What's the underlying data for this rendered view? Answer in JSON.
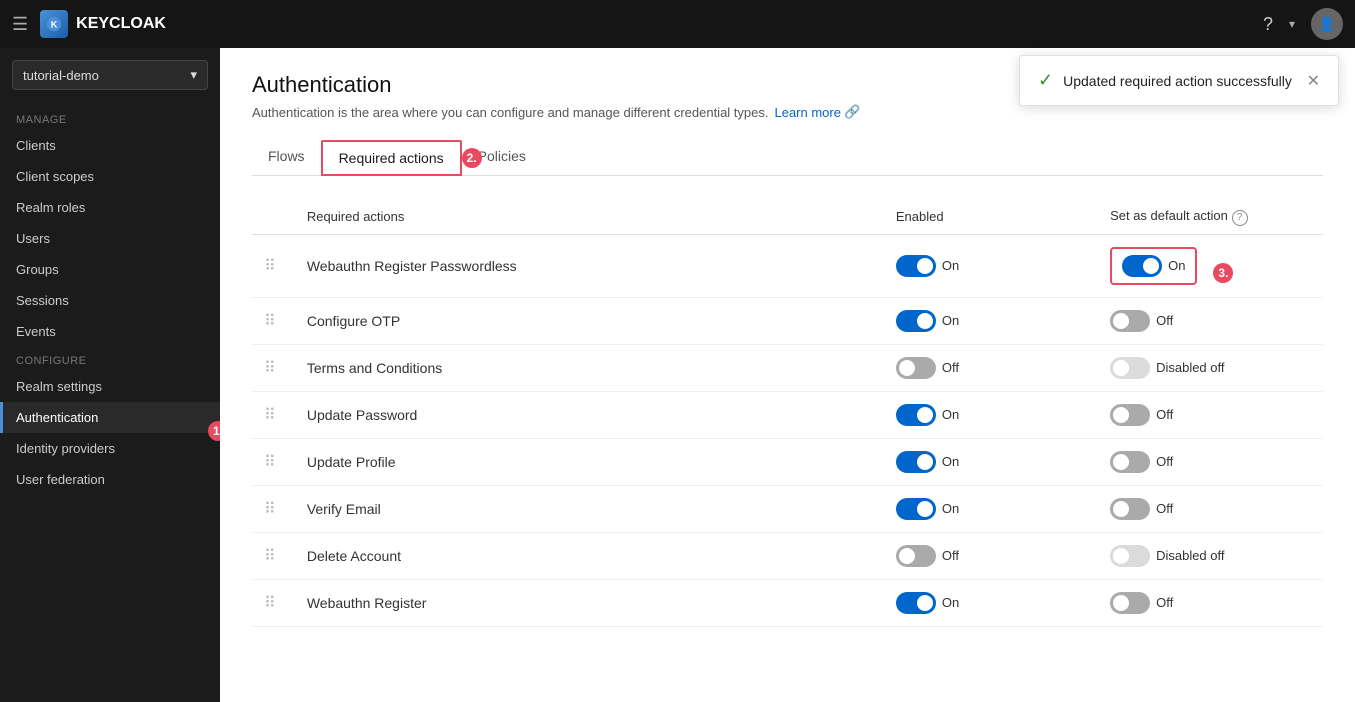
{
  "navbar": {
    "hamburger_icon": "☰",
    "brand_name": "KEYCLOAK",
    "help_icon": "?",
    "dropdown_arrow": "▾",
    "avatar_text": "👤"
  },
  "sidebar": {
    "realm_name": "tutorial-demo",
    "sections": {
      "manage_label": "Manage",
      "configure_label": "Configure"
    },
    "manage_items": [
      {
        "id": "clients",
        "label": "Clients",
        "active": false
      },
      {
        "id": "client-scopes",
        "label": "Client scopes",
        "active": false
      },
      {
        "id": "realm-roles",
        "label": "Realm roles",
        "active": false
      },
      {
        "id": "users",
        "label": "Users",
        "active": false
      },
      {
        "id": "groups",
        "label": "Groups",
        "active": false
      },
      {
        "id": "sessions",
        "label": "Sessions",
        "active": false
      },
      {
        "id": "events",
        "label": "Events",
        "active": false
      }
    ],
    "configure_items": [
      {
        "id": "realm-settings",
        "label": "Realm settings",
        "active": false
      },
      {
        "id": "authentication",
        "label": "Authentication",
        "active": true
      },
      {
        "id": "identity-providers",
        "label": "Identity providers",
        "active": false
      },
      {
        "id": "user-federation",
        "label": "User federation",
        "active": false
      }
    ]
  },
  "page": {
    "title": "Authentication",
    "description": "Authentication is the area where you can configure and manage different credential types.",
    "learn_more": "Learn more"
  },
  "tabs": [
    {
      "id": "flows",
      "label": "Flows",
      "active": false
    },
    {
      "id": "required-actions",
      "label": "Required actions",
      "active": true
    },
    {
      "id": "policies",
      "label": "Policies",
      "active": false
    }
  ],
  "table": {
    "headers": {
      "required_actions": "Required actions",
      "enabled": "Enabled",
      "set_as_default": "Set as default action"
    },
    "rows": [
      {
        "id": "webauthn-passwordless",
        "name": "Webauthn Register Passwordless",
        "enabled_state": "on",
        "enabled_label": "On",
        "default_state": "on",
        "default_label": "On",
        "default_disabled": false,
        "highlighted": true
      },
      {
        "id": "configure-otp",
        "name": "Configure OTP",
        "enabled_state": "on",
        "enabled_label": "On",
        "default_state": "off",
        "default_label": "Off",
        "default_disabled": false,
        "highlighted": false
      },
      {
        "id": "terms-conditions",
        "name": "Terms and Conditions",
        "enabled_state": "off",
        "enabled_label": "Off",
        "default_state": "disabled-off",
        "default_label": "Disabled off",
        "default_disabled": true,
        "highlighted": false
      },
      {
        "id": "update-password",
        "name": "Update Password",
        "enabled_state": "on",
        "enabled_label": "On",
        "default_state": "off",
        "default_label": "Off",
        "default_disabled": false,
        "highlighted": false
      },
      {
        "id": "update-profile",
        "name": "Update Profile",
        "enabled_state": "on",
        "enabled_label": "On",
        "default_state": "off",
        "default_label": "Off",
        "default_disabled": false,
        "highlighted": false
      },
      {
        "id": "verify-email",
        "name": "Verify Email",
        "enabled_state": "on",
        "enabled_label": "On",
        "default_state": "off",
        "default_label": "Off",
        "default_disabled": false,
        "highlighted": false
      },
      {
        "id": "delete-account",
        "name": "Delete Account",
        "enabled_state": "off",
        "enabled_label": "Off",
        "default_state": "disabled-off",
        "default_label": "Disabled off",
        "default_disabled": true,
        "highlighted": false
      },
      {
        "id": "webauthn-register",
        "name": "Webauthn Register",
        "enabled_state": "on",
        "enabled_label": "On",
        "default_state": "off",
        "default_label": "Off",
        "default_disabled": false,
        "highlighted": false
      }
    ]
  },
  "toast": {
    "message": "Updated required action successfully",
    "icon": "✓",
    "close_icon": "✕"
  },
  "annotations": {
    "badge_1": "1.",
    "badge_2": "2.",
    "badge_3": "3."
  }
}
